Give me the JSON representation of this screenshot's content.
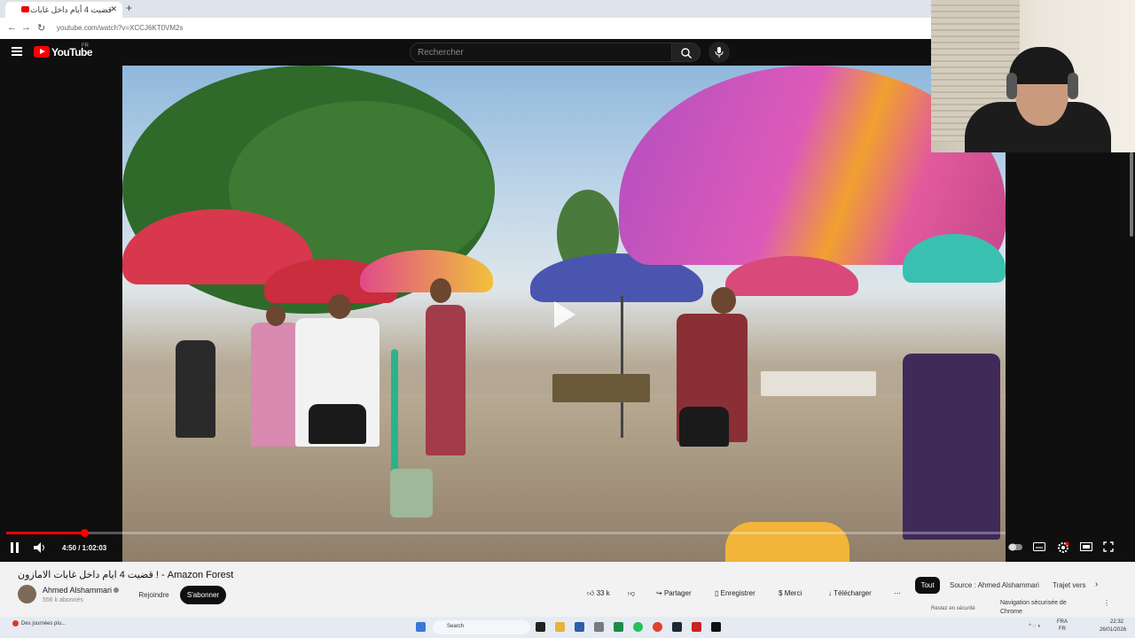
{
  "browser": {
    "tab_title": "قضيت 4 أيام داخل غابات",
    "address": "youtube.com/watch?v=XCCJ6KT0VM2s"
  },
  "header": {
    "logo_text": "YouTube",
    "region": "FR",
    "search_placeholder": "Rechercher"
  },
  "player": {
    "time": "4:50 / 1:02:03",
    "progress_fraction": 0.0785
  },
  "video_info": {
    "title": "قضيت 4 ايام داخل غابات الامازون ! - Amazon Forest",
    "channel": "Ahmed Alshammari",
    "subscribers": "556 k abonnés",
    "join": "Rejoindre",
    "subscribe": "S'abonner",
    "likes": "33 k",
    "share": "Partager",
    "save": "Enregistrer",
    "thanks": "Merci",
    "download": "Télécharger"
  },
  "side_chips": {
    "all": "Tout",
    "source": "Source : Ahmed Alshammari",
    "trajet": "Trajet vers",
    "safe_nav": "Navigation sécurisée de Chrome",
    "stay_safe": "Restez en sécurité"
  },
  "taskbar": {
    "notification": "Des journées plu...",
    "search": "Search",
    "lang": "FRA",
    "lang2": "FR",
    "clock": "22:32",
    "date": "26/01/2026"
  }
}
